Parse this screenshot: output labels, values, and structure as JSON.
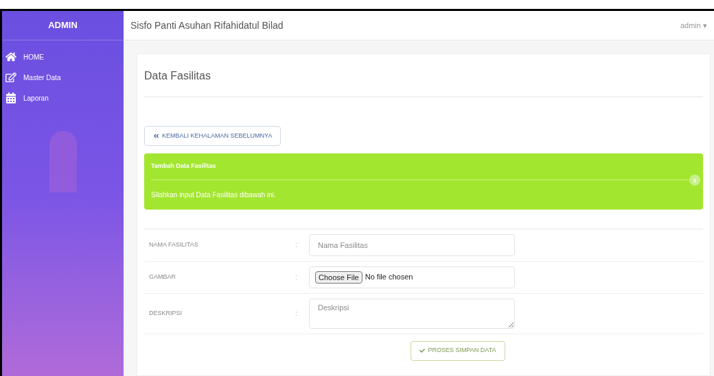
{
  "sidebar": {
    "brand": "ADMIN",
    "items": [
      {
        "label": "HOME"
      },
      {
        "label": "Master Data"
      },
      {
        "label": "Laporan"
      }
    ]
  },
  "topbar": {
    "title": "Sisfo Panti Asuhan Rifahidatul Bilad",
    "user": "admin",
    "caret": "▾"
  },
  "page": {
    "title": "Data Fasilitas",
    "back_button": "KEMBALI KEHALAMAN SEBELUMNYA",
    "alert": {
      "title": "Tambah Data Fasilitas",
      "message": "Silahkan input Data Fasilitas dibawah ini.",
      "close": "x"
    },
    "form": [
      {
        "kind": "text",
        "label": "NAMA FASILITAS",
        "colon": ":",
        "placeholder": "Nama Fasilitas"
      },
      {
        "kind": "file",
        "label": "GAMBAR",
        "colon": ":",
        "button": "Choose File",
        "status": "No file chosen"
      },
      {
        "kind": "textarea",
        "label": "DESKRIPSI",
        "colon": ":",
        "placeholder": "Deskripsi"
      }
    ],
    "submit": "PROSES SIMPAN DATA"
  }
}
